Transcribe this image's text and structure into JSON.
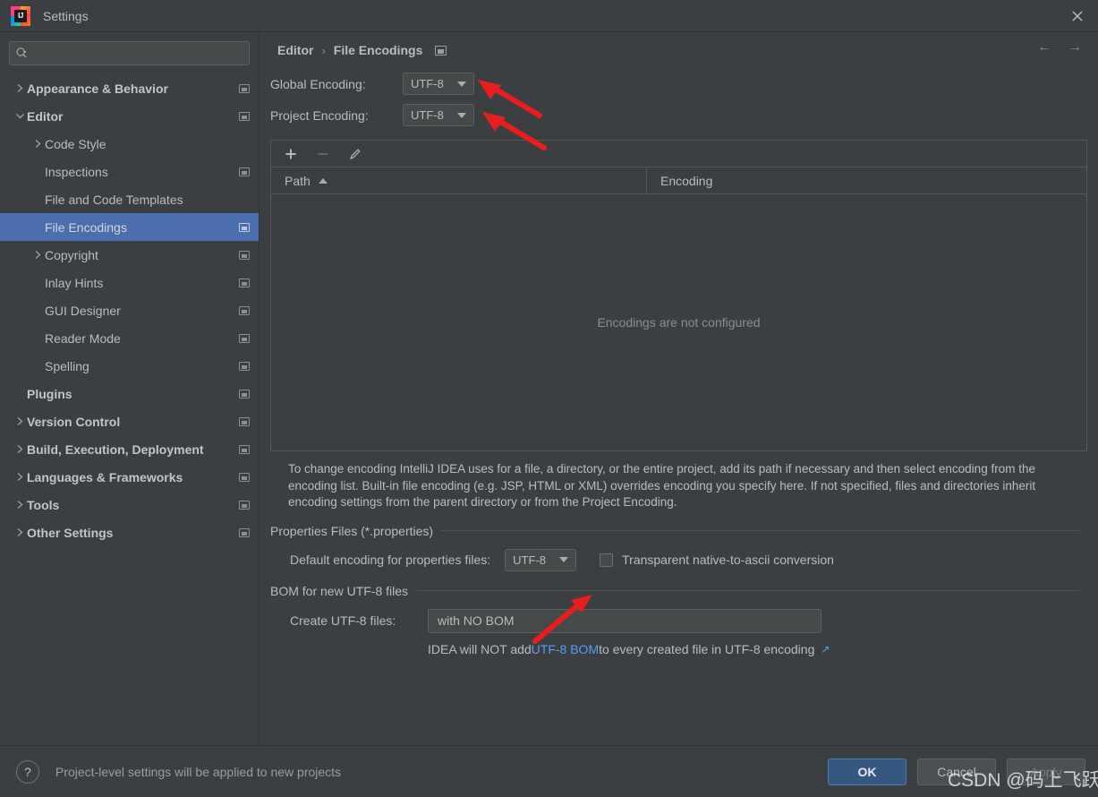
{
  "window": {
    "title": "Settings",
    "logo_text": "IJ",
    "close_icon": "close-icon"
  },
  "sidebar": {
    "search": {
      "value": "",
      "placeholder": ""
    },
    "items": [
      {
        "label": "Appearance & Behavior",
        "indent": 0,
        "arrow": "collapsed",
        "bold": true,
        "badge": true,
        "selected": false
      },
      {
        "label": "Editor",
        "indent": 0,
        "arrow": "expanded",
        "bold": true,
        "badge": true,
        "selected": false
      },
      {
        "label": "Code Style",
        "indent": 1,
        "arrow": "collapsed",
        "bold": false,
        "badge": false,
        "selected": false
      },
      {
        "label": "Inspections",
        "indent": 1,
        "arrow": "none",
        "bold": false,
        "badge": true,
        "selected": false
      },
      {
        "label": "File and Code Templates",
        "indent": 1,
        "arrow": "none",
        "bold": false,
        "badge": false,
        "selected": false
      },
      {
        "label": "File Encodings",
        "indent": 1,
        "arrow": "none",
        "bold": false,
        "badge": true,
        "selected": true
      },
      {
        "label": "Copyright",
        "indent": 1,
        "arrow": "collapsed",
        "bold": false,
        "badge": true,
        "selected": false
      },
      {
        "label": "Inlay Hints",
        "indent": 1,
        "arrow": "none",
        "bold": false,
        "badge": true,
        "selected": false
      },
      {
        "label": "GUI Designer",
        "indent": 1,
        "arrow": "none",
        "bold": false,
        "badge": true,
        "selected": false
      },
      {
        "label": "Reader Mode",
        "indent": 1,
        "arrow": "none",
        "bold": false,
        "badge": true,
        "selected": false
      },
      {
        "label": "Spelling",
        "indent": 1,
        "arrow": "none",
        "bold": false,
        "badge": true,
        "selected": false
      },
      {
        "label": "Plugins",
        "indent": 0,
        "arrow": "none",
        "bold": true,
        "badge": true,
        "selected": false
      },
      {
        "label": "Version Control",
        "indent": 0,
        "arrow": "collapsed",
        "bold": true,
        "badge": true,
        "selected": false
      },
      {
        "label": "Build, Execution, Deployment",
        "indent": 0,
        "arrow": "collapsed",
        "bold": true,
        "badge": true,
        "selected": false
      },
      {
        "label": "Languages & Frameworks",
        "indent": 0,
        "arrow": "collapsed",
        "bold": true,
        "badge": true,
        "selected": false
      },
      {
        "label": "Tools",
        "indent": 0,
        "arrow": "collapsed",
        "bold": true,
        "badge": true,
        "selected": false
      },
      {
        "label": "Other Settings",
        "indent": 0,
        "arrow": "collapsed",
        "bold": true,
        "badge": true,
        "selected": false
      }
    ]
  },
  "main": {
    "breadcrumb": {
      "parent": "Editor",
      "separator": "›",
      "current": "File Encodings"
    },
    "nav": {
      "back": "←",
      "forward": "→"
    },
    "global_encoding": {
      "label": "Global Encoding:",
      "value": "UTF-8"
    },
    "project_encoding": {
      "label": "Project Encoding:",
      "value": "UTF-8"
    },
    "table": {
      "toolbar": {
        "add": "+",
        "remove": "−",
        "edit": "pencil-icon"
      },
      "columns": [
        "Path",
        "Encoding"
      ],
      "sort_column": "Path",
      "sort_direction": "ascending",
      "rows": [],
      "empty_text": "Encodings are not configured"
    },
    "description": "To change encoding IntelliJ IDEA uses for a file, a directory, or the entire project, add its path if necessary and then select encoding from the encoding list. Built-in file encoding (e.g. JSP, HTML or XML) overrides encoding you specify here. If not specified, files and directories inherit encoding settings from the parent directory or from the Project Encoding.",
    "properties_group": {
      "title": "Properties Files (*.properties)",
      "default_encoding_label": "Default encoding for properties files:",
      "default_encoding_value": "UTF-8",
      "transparent_label": "Transparent native-to-ascii conversion",
      "transparent_checked": false
    },
    "bom_group": {
      "title": "BOM for new UTF-8 files",
      "create_label": "Create UTF-8 files:",
      "create_value": "with NO BOM",
      "hint_prefix": "IDEA will NOT add ",
      "hint_link": "UTF-8 BOM",
      "hint_suffix": " to every created file in UTF-8 encoding",
      "hint_external_icon": "↗"
    }
  },
  "footer": {
    "help_icon": "?",
    "note": "Project-level settings will be applied to new projects",
    "ok": "OK",
    "cancel": "Cancel",
    "apply": "Apply"
  },
  "watermark": {
    "text": "CSDN @码上飞跃"
  },
  "colors": {
    "background": "#3c3f41",
    "selection": "#4b6eaf",
    "primary_button": "#365880",
    "link": "#589df6",
    "annotation_arrow": "#e81d1d",
    "text": "#bbbbbb",
    "muted_text": "#8b8e90"
  }
}
